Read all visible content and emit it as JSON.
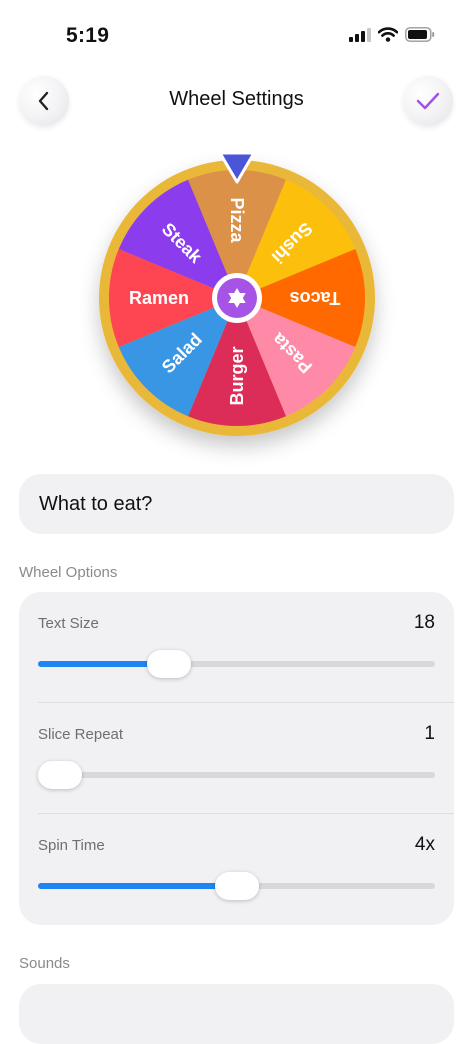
{
  "status_bar": {
    "time": "5:19",
    "icons": [
      "signal-icon",
      "wifi-icon",
      "battery-icon"
    ]
  },
  "header": {
    "title": "Wheel Settings",
    "back_icon": "chevron-left-icon",
    "done_icon": "checkmark-icon",
    "accent_color": "#a44ee8"
  },
  "wheel": {
    "pointer_color": "#4a55d8",
    "rim_color": "#e9b838",
    "center_icon": "star-of-david-icon",
    "center_color": "#a554e6",
    "slices": [
      {
        "label": "Pizza",
        "color": "#dc9148"
      },
      {
        "label": "Sushi",
        "color": "#fcc00c"
      },
      {
        "label": "Tacos",
        "color": "#ff6900"
      },
      {
        "label": "Pasta",
        "color": "#fe8aa8"
      },
      {
        "label": "Burger",
        "color": "#dc2c58"
      },
      {
        "label": "Salad",
        "color": "#3996e4"
      },
      {
        "label": "Ramen",
        "color": "#fd4651"
      },
      {
        "label": "Steak",
        "color": "#8b3ced"
      }
    ]
  },
  "name_field": {
    "value": "What to eat?"
  },
  "wheel_options": {
    "section_title": "Wheel Options",
    "accent_color": "#1d86f2",
    "items": [
      {
        "label": "Text Size",
        "value": "18",
        "fraction": 0.31
      },
      {
        "label": "Slice Repeat",
        "value": "1",
        "fraction": 0.0
      },
      {
        "label": "Spin Time",
        "value": "4x",
        "fraction": 0.5
      }
    ]
  },
  "sounds": {
    "section_title": "Sounds"
  }
}
